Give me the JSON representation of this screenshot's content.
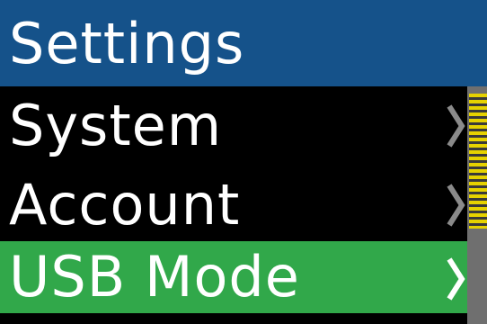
{
  "header": {
    "title": "Settings"
  },
  "menu": {
    "items": [
      {
        "label": "System",
        "icon": "chevron-right-icon",
        "selected": false
      },
      {
        "label": "Account",
        "icon": "chevron-right-icon",
        "selected": false
      },
      {
        "label": "USB Mode",
        "icon": "chevron-right-icon",
        "selected": true
      }
    ]
  },
  "colors": {
    "header_background": "#15528a",
    "selected_background": "#31a84a",
    "list_background": "#000000",
    "text": "#ffffff",
    "scroll_thumb": "#e6d200",
    "scroll_track": "#6f6f6f"
  }
}
